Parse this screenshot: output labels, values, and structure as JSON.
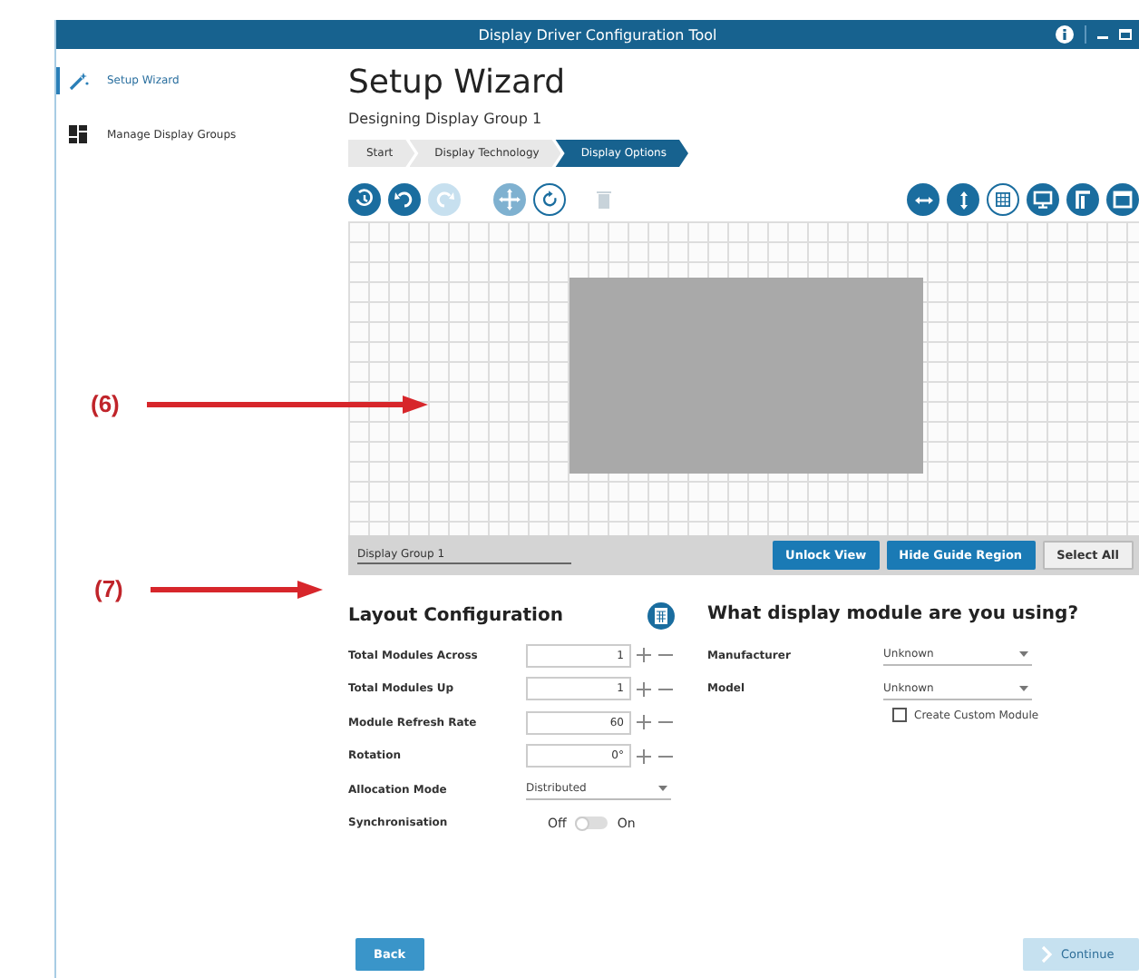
{
  "annotations": [
    {
      "label": "(6)"
    },
    {
      "label": "(7)"
    }
  ],
  "window": {
    "title": "Display Driver Configuration Tool"
  },
  "sidebar": {
    "items": [
      {
        "label": "Setup Wizard",
        "kind": "wand",
        "selected": true
      },
      {
        "label": "Manage Display Groups",
        "kind": "tiles",
        "selected": false
      }
    ]
  },
  "page": {
    "title": "Setup Wizard",
    "subtitle": "Designing Display Group 1"
  },
  "steps": [
    {
      "label": "Start",
      "selected": false
    },
    {
      "label": "Display Technology",
      "selected": false
    },
    {
      "label": "Display Options",
      "selected": true
    }
  ],
  "toolbar": {
    "left": [
      {
        "kind": "history",
        "disabled": false
      },
      {
        "kind": "undo",
        "disabled": false
      },
      {
        "kind": "redo",
        "disabled": true
      },
      {
        "kind": "move"
      },
      {
        "kind": "rotate"
      },
      {
        "kind": "delete",
        "disabled": true
      }
    ],
    "right": [
      {
        "kind": "width",
        "disabled": false
      },
      {
        "kind": "height",
        "disabled": false
      },
      {
        "kind": "grid"
      },
      {
        "kind": "monitor",
        "disabled": false
      },
      {
        "kind": "corner",
        "disabled": false
      },
      {
        "kind": "frame",
        "disabled": false
      }
    ]
  },
  "canvas": {
    "group_name": "Display Group 1",
    "buttons": [
      {
        "label": "Unlock View",
        "kind": "primary"
      },
      {
        "label": "Hide Guide Region",
        "kind": "primary"
      },
      {
        "label": "Select All",
        "kind": "plain"
      }
    ]
  },
  "layout": {
    "title": "Layout Configuration",
    "fields": [
      {
        "label": "Total Modules Across",
        "value": "1"
      },
      {
        "label": "Total Modules Up",
        "value": "1"
      },
      {
        "label": "Module Refresh Rate",
        "value": "60"
      },
      {
        "label": "Rotation",
        "value": "0°"
      }
    ],
    "allocation": {
      "label": "Allocation Mode",
      "value": "Distributed"
    },
    "sync": {
      "label": "Synchronisation",
      "off_label": "Off",
      "on_label": "On",
      "on": false
    }
  },
  "module": {
    "title": "What display module are you using?",
    "selects": [
      {
        "label": "Manufacturer",
        "value": "Unknown"
      },
      {
        "label": "Model",
        "value": "Unknown"
      }
    ],
    "custom": {
      "label": "Create Custom Module",
      "checked": false
    }
  },
  "footer": {
    "back": {
      "label": "Back",
      "disabled": false
    },
    "continue": {
      "label": "Continue",
      "disabled": true
    }
  }
}
